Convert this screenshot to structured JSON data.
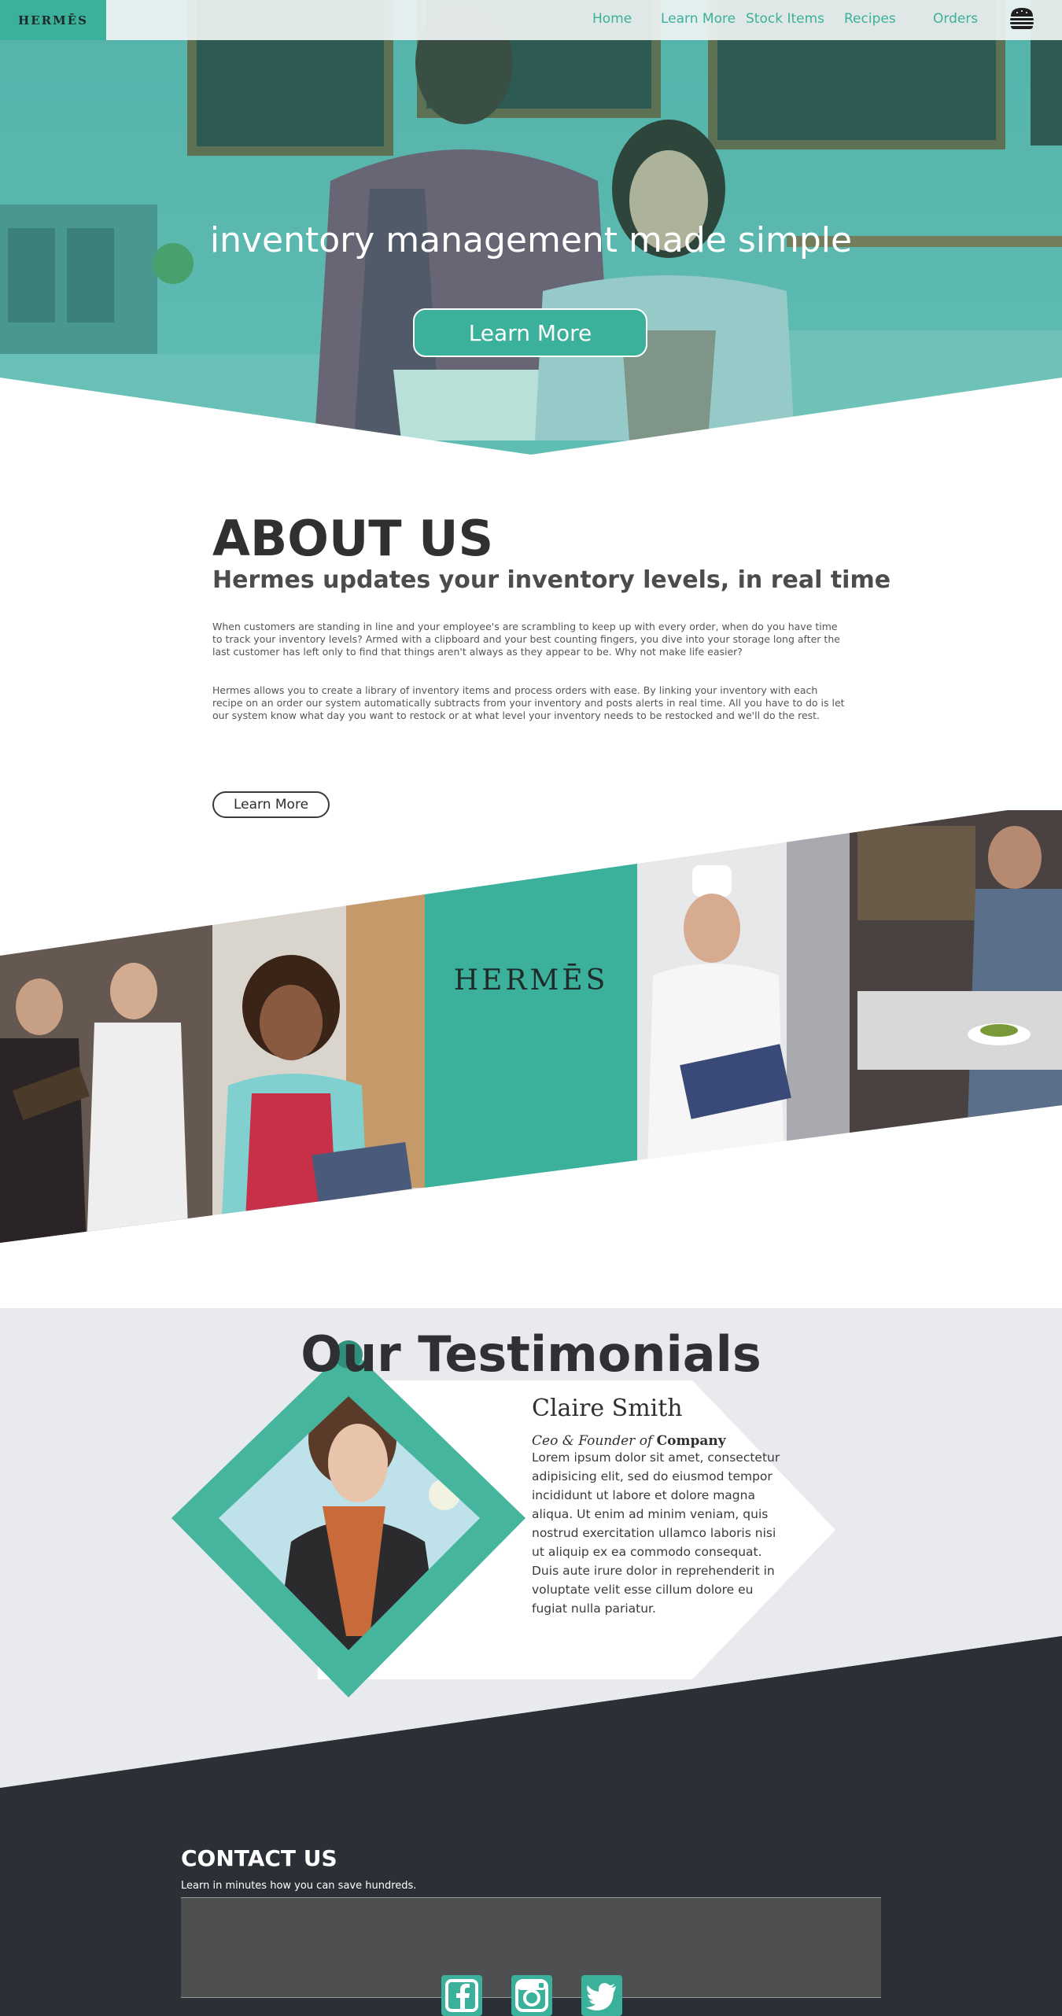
{
  "nav": {
    "logo": "HERMĒS",
    "links": [
      "Home",
      "Learn More",
      "Stock Items",
      "Recipes",
      "Orders"
    ],
    "menu_icon": "hamburger-icon"
  },
  "hero": {
    "title": "inventory management made simple",
    "button": "Learn More"
  },
  "about": {
    "title": "ABOUT US",
    "subtitle": "Hermes updates your inventory levels, in real time",
    "paragraphs": [
      "When customers are standing in line and your employee's are scrambling to keep up with every order, when do you have time to track your inventory levels? Armed with a clipboard and your best counting fingers, you dive into your storage long after the last customer has left only to find that things aren't always as they appear to be. Why not make life easier?",
      "Hermes allows you to create a library of inventory items and process orders with ease. By linking your inventory with each recipe on an order our system automatically subtracts from your inventory and posts alerts in real time. All you have to do is let our system know what day you want to restock or at what level your inventory needs to be restocked and we'll do the rest."
    ],
    "button": "Learn More"
  },
  "strip": {
    "brand": "HERMĒS"
  },
  "testimonials": {
    "title": "Our Testimonials",
    "name": "Claire Smith",
    "role_prefix": "Ceo & Founder of",
    "role_company": "Company",
    "body": "Lorem ipsum dolor sit amet, consectetur adipisicing elit, sed do eiusmod tempor incididunt ut labore et dolore magna aliqua. Ut enim ad minim veniam, quis nostrud exercitation ullamco laboris nisi ut aliquip ex ea commodo consequat. Duis aute irure dolor in reprehenderit in voluptate velit esse cillum dolore eu fugiat nulla pariatur."
  },
  "contact": {
    "title": "CONTACT US",
    "subtitle": "Learn in minutes how you can save hundreds."
  },
  "social": [
    "facebook-icon",
    "instagram-icon",
    "twitter-icon"
  ],
  "colors": {
    "accent": "#3bb09a",
    "dark": "#2b3036",
    "light_gray": "#e8eaed"
  }
}
